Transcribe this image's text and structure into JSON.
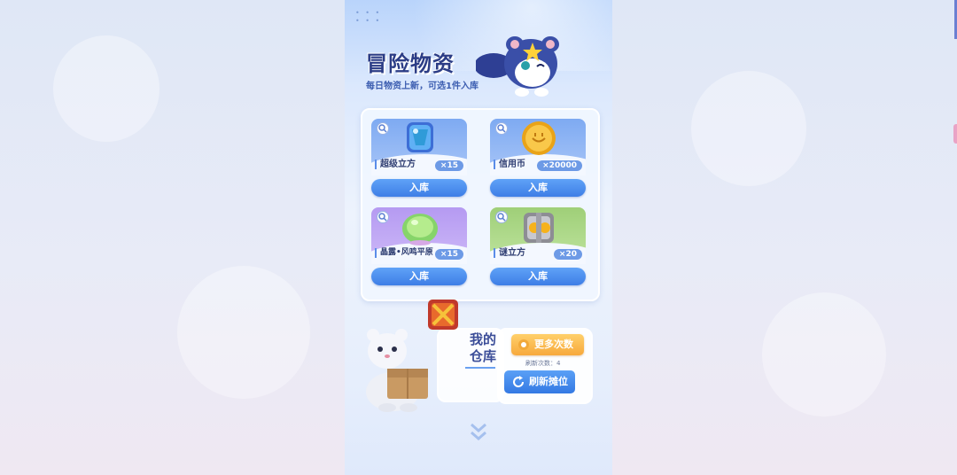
{
  "header": {
    "title": "冒险物资",
    "subtitle": "每日物资上新，可选1件入库"
  },
  "items": [
    {
      "name": "超级立方",
      "qty": "×15",
      "button": "入库",
      "theme": "#7aa6f0"
    },
    {
      "name": "信用币",
      "qty": "×20000",
      "button": "入库",
      "theme": "#7aa6f0"
    },
    {
      "name": "晶露•风鸣平原",
      "qty": "×15",
      "button": "入库",
      "theme": "#b49af0"
    },
    {
      "name": "谜立方",
      "qty": "×20",
      "button": "入库",
      "theme": "#9fd07a"
    }
  ],
  "warehouse": {
    "label": "我的仓库"
  },
  "actions": {
    "more_label": "更多次数",
    "refresh_count": "刷新次数：4",
    "refresh_label": "刷新摊位"
  },
  "colors": {
    "primary_blue": "#3e7ee6",
    "orange": "#f7a93c",
    "title_navy": "#2c3d86"
  }
}
